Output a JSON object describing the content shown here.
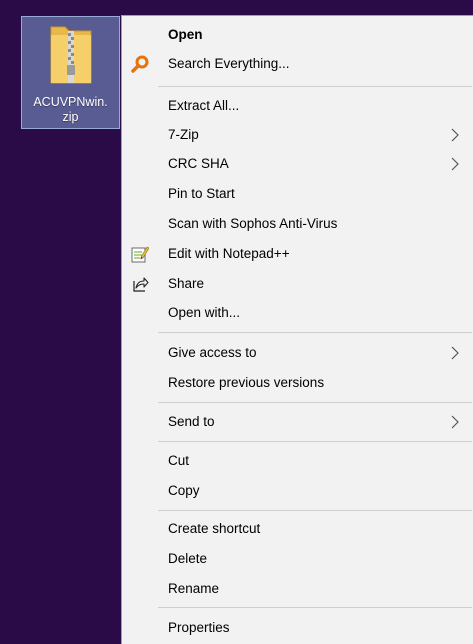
{
  "desktop": {
    "file": {
      "name_line1": "ACUVPNwin.",
      "name_line2": "zip",
      "icon": "zip-folder-icon"
    }
  },
  "menu": {
    "items": [
      {
        "label": "Open",
        "bold": true
      },
      {
        "label": "Search Everything...",
        "icon": "search-icon"
      },
      {
        "label": "Extract All..."
      },
      {
        "label": "7-Zip",
        "submenu": true
      },
      {
        "label": "CRC SHA",
        "submenu": true
      },
      {
        "label": "Pin to Start"
      },
      {
        "label": "Scan with Sophos Anti-Virus"
      },
      {
        "label": "Edit with Notepad++",
        "icon": "notepad-plus-plus-icon"
      },
      {
        "label": "Share",
        "icon": "share-icon"
      },
      {
        "label": "Open with..."
      },
      {
        "label": "Give access to",
        "submenu": true
      },
      {
        "label": "Restore previous versions"
      },
      {
        "label": "Send to",
        "submenu": true
      },
      {
        "label": "Cut"
      },
      {
        "label": "Copy"
      },
      {
        "label": "Create shortcut"
      },
      {
        "label": "Delete"
      },
      {
        "label": "Rename"
      },
      {
        "label": "Properties"
      }
    ]
  },
  "colors": {
    "desktop_bg": "#2a0b47",
    "menu_bg": "#f2f2f2",
    "selection": "#7fa0d2"
  }
}
